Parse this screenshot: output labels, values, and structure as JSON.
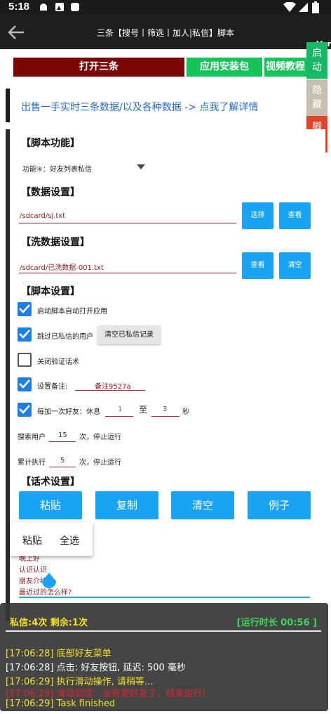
{
  "status_bar": {
    "time": "5:18"
  },
  "app_bar": {
    "title": "三条【搜号丨筛选丨加人|私信】脚本",
    "version": "Ver"
  },
  "top_buttons": [
    {
      "label": "打开三条",
      "color": "#7a0606"
    },
    {
      "label": "应用安装包",
      "color": "#14c35a"
    },
    {
      "label": "视频教程",
      "color": "#14c35a"
    }
  ],
  "side_tabs": [
    {
      "label": "启\n动",
      "color": "#19b866"
    },
    {
      "label": "隐\n藏",
      "color": "#c5c0b0"
    },
    {
      "label": "脚\n本",
      "color": "#e04429"
    }
  ],
  "banner": {
    "text": "出售一手实时三条数据/以及各种数据 -> 点我了解详情"
  },
  "script_function": {
    "header": "【脚本功能】",
    "selected": "功能④：好友列表私信"
  },
  "data_settings": {
    "header": "【数据设置】",
    "path": "/sdcard/sj.txt",
    "choose_label": "选择",
    "view_label": "查看"
  },
  "wash_settings": {
    "header": "【洗数据设置】",
    "path": "/sdcard/已洗数据-001.txt",
    "view_label": "查看",
    "clear_label": "清空"
  },
  "script_settings": {
    "header": "【脚本设置】",
    "auto_open": {
      "label": "启动脚本自动打开应用",
      "checked": true
    },
    "skip_messaged": {
      "label": "跳过已私信的用户",
      "checked": true,
      "clear_button": "清空已私信记录"
    },
    "close_verify": {
      "label": "关闭验证话术",
      "checked": false
    },
    "set_note": {
      "label": "设置备注:",
      "checked": true,
      "value": "备注9527a"
    },
    "rest": {
      "label": "每加一次好友：休息",
      "checked": true,
      "from": "1",
      "to_label": "至",
      "to": "3",
      "unit": "秒"
    },
    "search_users": {
      "label": "搜索用户",
      "value": "15",
      "suffix": "次，停止运行"
    },
    "cumulative": {
      "label": "累计执行",
      "value": "5",
      "suffix": "次，停止运行"
    }
  },
  "script_text": {
    "header": "【话术设置】",
    "buttons": [
      "粘贴",
      "复制",
      "清空",
      "例子"
    ],
    "popup": [
      "粘贴",
      "全选"
    ],
    "lines": [
      "晚上好",
      "认识认识",
      "朋友介绍",
      "最近过的怎么样?"
    ]
  },
  "log": {
    "header": "私信:4次 剩余:1次",
    "runtime": "[运行时长 00:56 ]",
    "lines": [
      {
        "text": "[17:06:28] 底部好友菜单",
        "color": "#f5e02a"
      },
      {
        "text": "[17:06:28] 点击: 好友按钮, 延迟: 500 毫秒",
        "color": "#ffffff"
      },
      {
        "text": "[17:06:29] 执行滑动操作, 请稍等...",
        "color": "#f5e02a"
      },
      {
        "text": "[17:06:29] 滑动到底：没有更好友了，结束运行!",
        "color": "#e0262d"
      },
      {
        "text": "[17:06:29] Task finished",
        "color": "#f5e02a"
      }
    ]
  }
}
